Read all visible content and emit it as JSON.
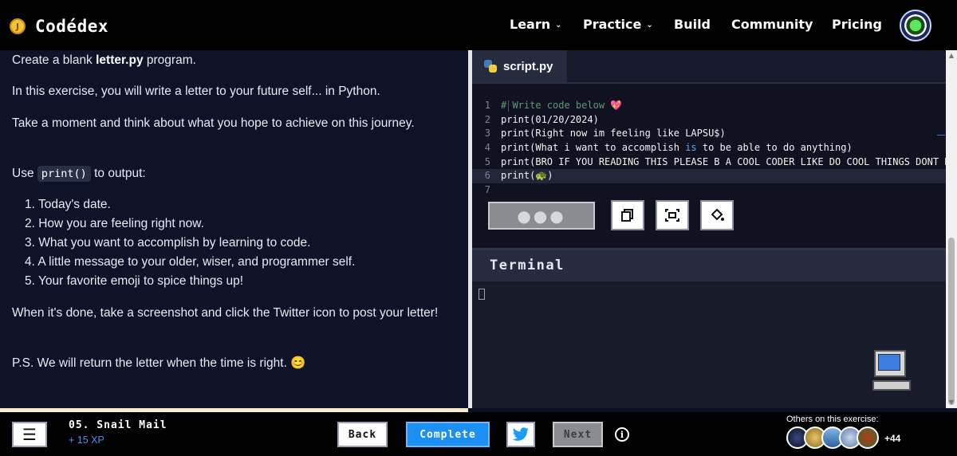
{
  "nav": {
    "brand": "Codédex",
    "coin_glyph": "J",
    "items": [
      {
        "label": "Learn",
        "has_dropdown": true
      },
      {
        "label": "Practice",
        "has_dropdown": true
      },
      {
        "label": "Build",
        "has_dropdown": false
      },
      {
        "label": "Community",
        "has_dropdown": false
      },
      {
        "label": "Pricing",
        "has_dropdown": false
      }
    ],
    "chevron": "⌄"
  },
  "lesson": {
    "intro_prefix": "Create a blank ",
    "intro_file": "letter.py",
    "intro_suffix": " program.",
    "p2": "In this exercise, you will write a letter to your future self... in Python.",
    "p3": "Take a moment and think about what you hope to achieve on this journey.",
    "use_prefix": "Use ",
    "use_code": "print()",
    "use_suffix": " to output:",
    "steps": [
      "1. Today's date.",
      "2. How you are feeling right now.",
      "3. What you want to accomplish by learning to code.",
      "4. A little message to your older, wiser, and programmer self.",
      "5. Your favorite emoji to spice things up!"
    ],
    "p5": "When it's done, take a screenshot and click the Twitter icon to post your letter!",
    "p6": "P.S. We will return the letter when the time is right. 😊"
  },
  "editor": {
    "file_name": "script.py",
    "icons": {
      "file": "python-icon",
      "copy": "copy-icon",
      "screenshot": "screenshot-icon",
      "theme": "paint-bucket-icon"
    },
    "run_glyph": "●●●",
    "lines": [
      {
        "num": "1",
        "parts": [
          {
            "t": "# Write code below 💖",
            "c": "cmt"
          }
        ]
      },
      {
        "num": "2",
        "parts": [
          {
            "t": "print(01/20/2024)",
            "c": "txt"
          }
        ]
      },
      {
        "num": "3",
        "parts": [
          {
            "t": "print(Right now im feeling like LAPSU$)",
            "c": "txt"
          }
        ]
      },
      {
        "num": "4",
        "parts": [
          {
            "t": "print(What i want to accomplish ",
            "c": "txt"
          },
          {
            "t": "is",
            "c": "kw"
          },
          {
            "t": " to be able to do anything)",
            "c": "txt"
          }
        ]
      },
      {
        "num": "5",
        "parts": [
          {
            "t": "print(BRO IF YOU READING THIS PLEASE B A COOL CODER LIKE DO COOL THINGS DONT B",
            "c": "txt"
          }
        ]
      },
      {
        "num": "6",
        "parts": [
          {
            "t": "print(🐢)",
            "c": "txt"
          }
        ]
      },
      {
        "num": "7",
        "parts": []
      }
    ],
    "active_line": 6
  },
  "terminal": {
    "title": "Terminal",
    "icon": "computer-icon"
  },
  "footer": {
    "menu_glyph": "☰",
    "exercise_title": "05. Snail Mail",
    "xp": "+ 15 XP",
    "back_label": "Back",
    "complete_label": "Complete",
    "twitter_icon": "twitter-icon",
    "next_label": "Next",
    "info_glyph": "i",
    "others_label": "Others on this exercise:",
    "others_count": "+44"
  },
  "colors": {
    "accent_blue": "#1b8ff3",
    "panel_bg": "#0e1329",
    "editor_bg": "#10131f",
    "xp_blue": "#4f8ff7"
  }
}
